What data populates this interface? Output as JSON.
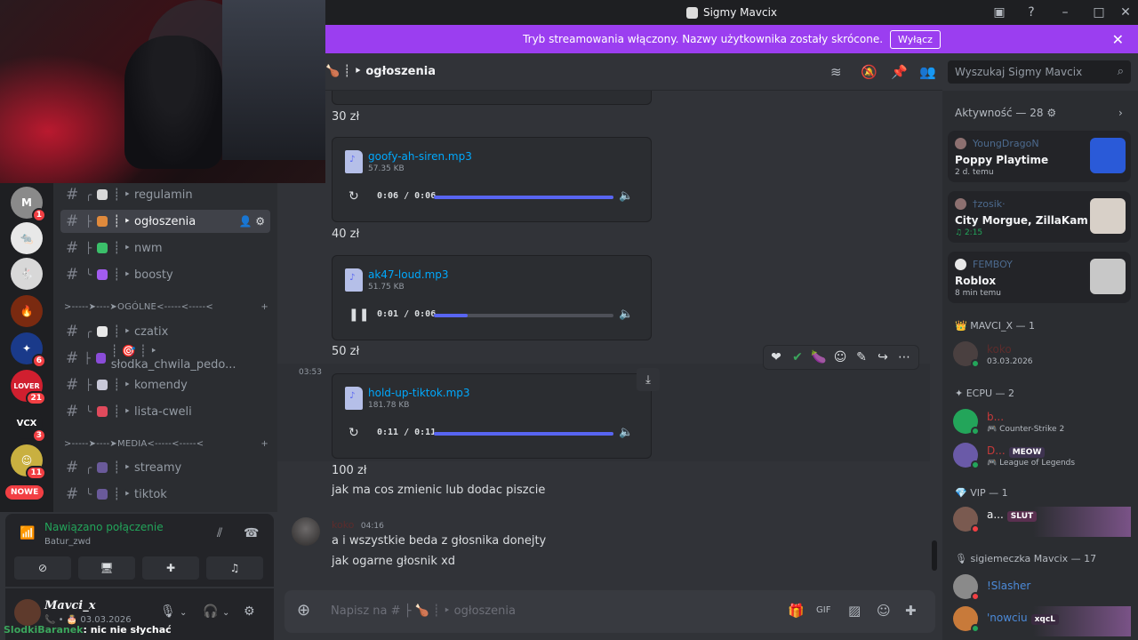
{
  "window": {
    "title": "Sigmy Mavcix"
  },
  "banner": {
    "text": "Tryb streamowania włączony. Nazwy użytkownika zostały skrócone.",
    "button": "Wyłącz"
  },
  "servers": [
    {
      "icon": "server-m-icon",
      "badge": "1",
      "color": "#8a8a8a",
      "label": "M"
    },
    {
      "icon": "server-rats-icon",
      "badge": "",
      "color": "#e8e8e8",
      "label": ""
    },
    {
      "icon": "server-bunny-icon",
      "badge": "",
      "color": "#d8d8d8",
      "label": ""
    },
    {
      "icon": "server-fire-icon",
      "badge": "",
      "color": "#7a2a10",
      "label": ""
    },
    {
      "icon": "server-blue-icon",
      "badge": "6",
      "color": "#1a3a8a",
      "label": ""
    },
    {
      "icon": "server-lover-icon",
      "badge": "21",
      "color": "#d01f2f",
      "label": "LOVER"
    },
    {
      "icon": "server-vcx-icon",
      "badge": "3",
      "color": "#1e1f22",
      "label": "VCX"
    },
    {
      "icon": "server-anime-icon",
      "badge": "11",
      "color": "#c9b040",
      "label": ""
    }
  ],
  "nowe_label": "NOWE",
  "channels": {
    "items": [
      {
        "tree": "╭",
        "label": "┊ ‣ regulamin",
        "emoji_color": "#d8d8d8"
      },
      {
        "tree": "├",
        "label": "┊ ‣ ogłoszenia",
        "emoji_color": "#e08a3c",
        "active": true
      },
      {
        "tree": "├",
        "label": "┊ ‣ nwm",
        "emoji_color": "#3bbf6a"
      },
      {
        "tree": "╰",
        "label": "┊ ‣ boosty",
        "emoji_color": "#a35cf0"
      }
    ],
    "category1": ">-----➤----➤OGÓLNE<-----<-----<",
    "items2": [
      {
        "tree": "╭",
        "label": "┊ ‣ czatix",
        "emoji_color": "#e8e8e8"
      },
      {
        "tree": "├",
        "label": "┊ 🎯 ┊ ‣ słodka_chwila_pedo...",
        "emoji_color": "#8a4cd8"
      },
      {
        "tree": "├",
        "label": "┊ ‣ komendy",
        "emoji_color": "#c8c8d8"
      },
      {
        "tree": "╰",
        "label": "┊ ‣ lista-cweli",
        "emoji_color": "#e04a5c"
      }
    ],
    "category2": ">-----➤----➤MEDIA<-----<-----<",
    "items3": [
      {
        "tree": "╭",
        "label": "┊ ‣ streamy",
        "emoji_color": "#6a5a9a"
      },
      {
        "tree": "╰",
        "label": "┊ ‣ tiktok",
        "emoji_color": "#6a5a9a"
      }
    ]
  },
  "voice": {
    "status": "Nawiązano połączenie",
    "channel": "Batur_zwd"
  },
  "user": {
    "name": "Mavci_x",
    "status": "03.03.2026"
  },
  "overlay": {
    "nick": "SlodkiBaranek",
    "text": ": nic nie słychać"
  },
  "chat_header": {
    "channel": "┊ ‣ ogłoszenia"
  },
  "search": {
    "placeholder": "Wyszukaj Sigmy Mavcix"
  },
  "messages": {
    "price1": "30 zł",
    "audio1": {
      "name": "goofy-ah-siren.mp3",
      "size": "57.35 KB",
      "time": "0:06 / 0:06",
      "progress": 1.0,
      "state": "ended"
    },
    "price2": "40 zł",
    "audio2": {
      "name": "ak47-loud.mp3",
      "size": "51.75 KB",
      "time": "0:01 / 0:06",
      "progress": 0.19,
      "state": "playing"
    },
    "price3": "50 zł",
    "stamp": "03:53",
    "audio3": {
      "name": "hold-up-tiktok.mp3",
      "size": "181.78 KB",
      "time": "0:11 / 0:11",
      "progress": 1.0,
      "state": "ended"
    },
    "price4": "100 zł",
    "line1": "jak ma cos zmienic lub dodac piszcie",
    "author": "koko",
    "author_time": "04:16",
    "line2": "a i wszystkie beda z głosnika donejty",
    "line3": "jak ogarne głosnik xd"
  },
  "composer": {
    "placeholder": "Napisz na # ├ 🍗 ┊ ‣ ogłoszenia"
  },
  "members": {
    "activity_header": "Aktywność — 28",
    "activities": [
      {
        "user": "YoungDragoN",
        "game": "Poppy Playtime",
        "time": "2 d. temu",
        "thumb": "#2a5ad8"
      },
      {
        "user": "†zosik·",
        "game": "City Morgue, ZillaKami, So...",
        "time": "2:15",
        "thumb": "#d8d0c8",
        "music": true
      },
      {
        "user": "FEMBOY",
        "game": "Roblox",
        "time": "8 min temu",
        "thumb": "#c8c8c8"
      }
    ],
    "group1": "MAVCI_X — 1",
    "g1": [
      {
        "name": "koko",
        "sub": "03.03.2026",
        "color": "#5c2c2c",
        "status": "#23a55a"
      }
    ],
    "group2": "ECPU — 2",
    "g2": [
      {
        "name": "b...",
        "sub": "Counter-Strike 2",
        "color": "#c83a3a",
        "status": "#23a55a"
      },
      {
        "name": "D...",
        "sub": "League of Legends",
        "color": "#c83a3a",
        "status": "#23a55a",
        "tag": "MEOW"
      }
    ],
    "group3": "VIP — 1",
    "g3": [
      {
        "name": "a...",
        "sub": "",
        "color": "#f2f3f5",
        "status": "#f23f43",
        "tag": "SLUT"
      }
    ],
    "group4": "sigiemeczka Mavcix — 17",
    "g4": [
      {
        "name": "!Slasher",
        "sub": "",
        "color": "#4c8ad8",
        "status": "#f23f43"
      },
      {
        "name": "'nowciu",
        "sub": "",
        "color": "#4c8ad8",
        "status": "#23a55a",
        "tag": "xqcL"
      }
    ]
  }
}
